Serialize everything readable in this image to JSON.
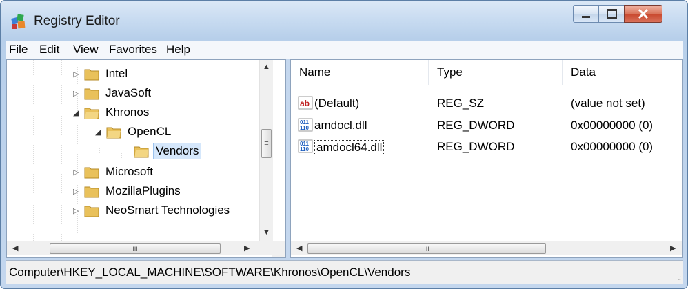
{
  "window": {
    "title": "Registry Editor"
  },
  "menu": {
    "items": [
      "File",
      "Edit",
      "View",
      "Favorites",
      "Help"
    ]
  },
  "tree": {
    "items": [
      {
        "label": "Intel",
        "depth": 0,
        "expander": "▷"
      },
      {
        "label": "JavaSoft",
        "depth": 0,
        "expander": "▷"
      },
      {
        "label": "Khronos",
        "depth": 0,
        "expander": "◢"
      },
      {
        "label": "OpenCL",
        "depth": 1,
        "expander": "◢"
      },
      {
        "label": "Vendors",
        "depth": 2,
        "expander": "",
        "selected": true
      },
      {
        "label": "Microsoft",
        "depth": 0,
        "expander": "▷"
      },
      {
        "label": "MozillaPlugins",
        "depth": 0,
        "expander": "▷"
      },
      {
        "label": "NeoSmart Technologies",
        "depth": 0,
        "expander": "▷"
      }
    ]
  },
  "list": {
    "columns": [
      "Name",
      "Type",
      "Data"
    ],
    "rows": [
      {
        "name": "(Default)",
        "type": "REG_SZ",
        "data": "(value not set)",
        "icon": "string-value-icon"
      },
      {
        "name": "amdocl.dll",
        "type": "REG_DWORD",
        "data": "0x00000000 (0)",
        "icon": "binary-value-icon"
      },
      {
        "name": "amdocl64.dll",
        "type": "REG_DWORD",
        "data": "0x00000000 (0)",
        "icon": "binary-value-icon",
        "focused": true
      }
    ]
  },
  "statusbar": {
    "path": "Computer\\HKEY_LOCAL_MACHINE\\SOFTWARE\\Khronos\\OpenCL\\Vendors"
  },
  "scroll_glyph": "III",
  "colors": {
    "folder": "#e9c15b",
    "selection": "#d5e7fb",
    "close_button": "#c8472c"
  }
}
